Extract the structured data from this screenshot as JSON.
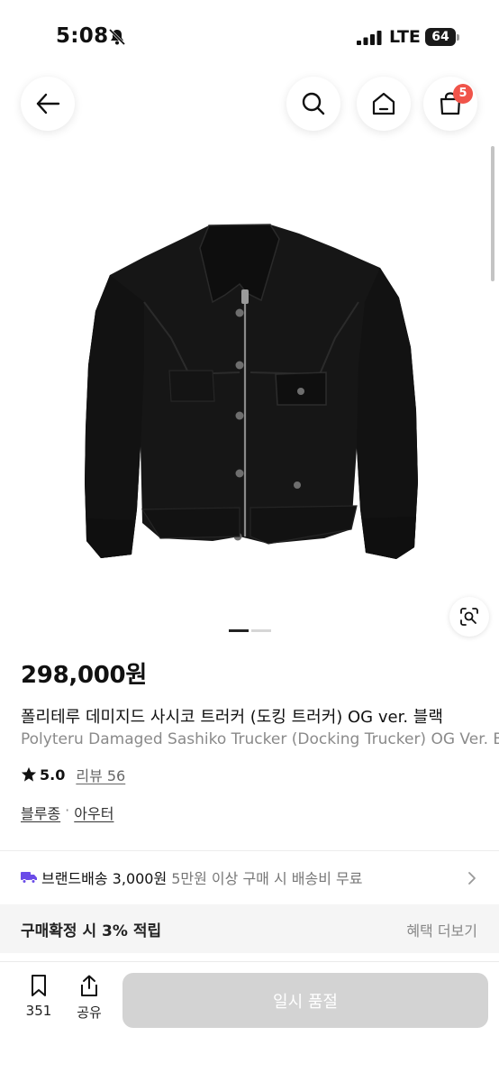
{
  "status_bar": {
    "time": "5:08",
    "network": "LTE",
    "battery": "64"
  },
  "header": {
    "cart_count": "5"
  },
  "product": {
    "price": "298,000원",
    "name_ko": "폴리테루 데미지드 사시코 트러커 (도킹 트러커) OG ver. 블랙",
    "name_en": "Polyteru Damaged Sashiko Trucker (Docking Trucker) OG Ver. Black",
    "rating": "5.0",
    "review_label": "리뷰 56",
    "categories": [
      "블루종",
      "아우터"
    ],
    "category_separator": "·"
  },
  "shipping": {
    "title": "브랜드배송 3,000원",
    "note": "5만원 이상 구매 시 배송비 무료"
  },
  "points": {
    "text": "구매확정 시 3% 적립",
    "benefit_link": "혜택 더보기"
  },
  "bottom_bar": {
    "bookmark_count": "351",
    "share_label": "공유",
    "soldout_label": "일시 품절"
  },
  "colors": {
    "badge": "#f0544a",
    "disabled_button": "#d3d3d3",
    "shipping_icon": "#6a4be8"
  }
}
